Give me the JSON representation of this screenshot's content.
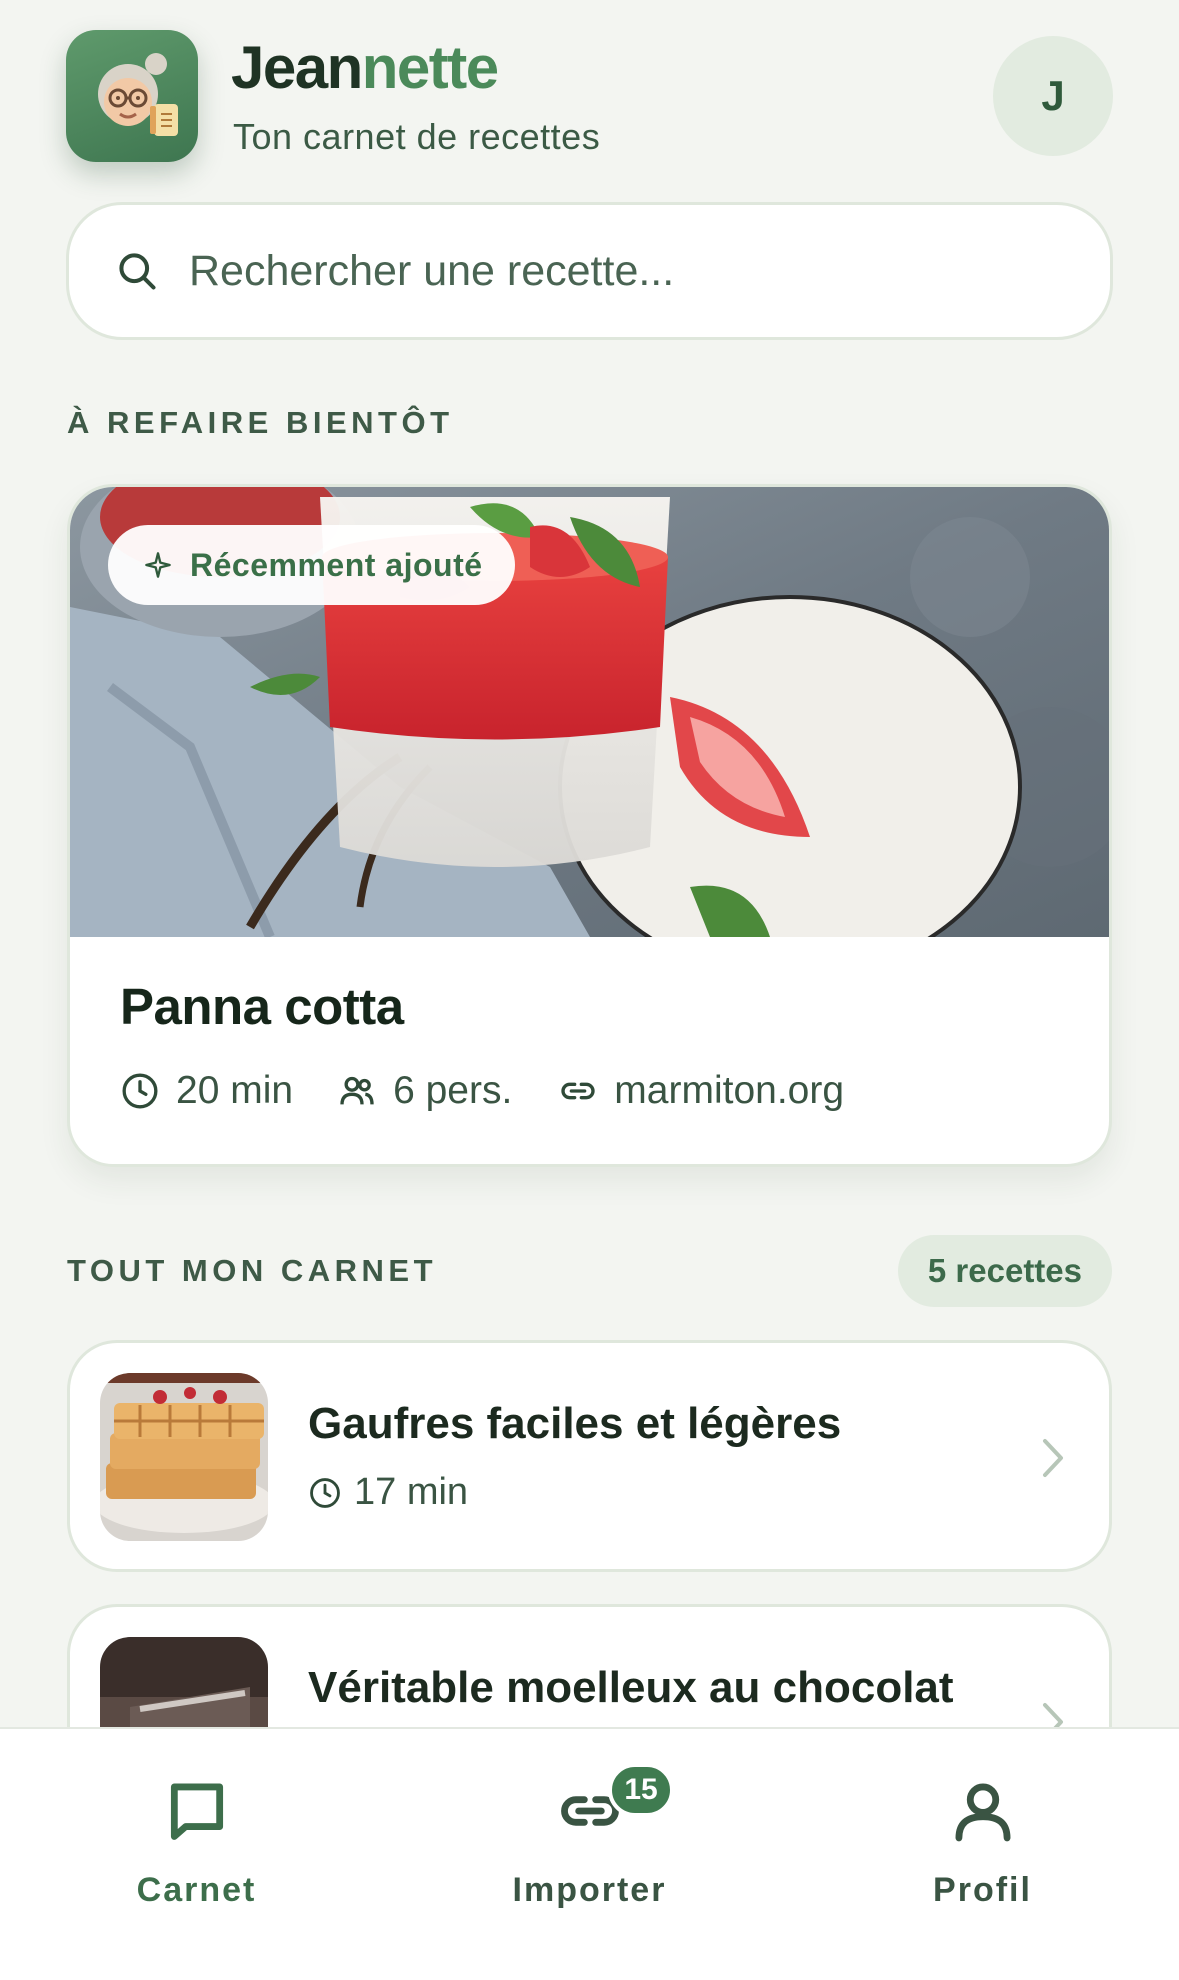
{
  "header": {
    "brand_first": "Jean",
    "brand_accent": "nette",
    "subtitle": "Ton carnet de recettes",
    "avatar_initial": "J"
  },
  "search": {
    "placeholder": "Rechercher une recette..."
  },
  "sections": {
    "soon_label": "À REFAIRE BIENTÔT",
    "all_label": "TOUT MON CARNET",
    "count": "5 recettes"
  },
  "featured": {
    "badge": "Récemment ajouté",
    "title": "Panna cotta",
    "time": "20 min",
    "servings": "6 pers.",
    "source": "marmiton.org"
  },
  "recipes": [
    {
      "title": "Gaufres faciles et légères",
      "time": "17 min"
    },
    {
      "title": "Véritable moelleux au chocolat",
      "time": ""
    }
  ],
  "nav": {
    "items": [
      {
        "label": "Carnet",
        "icon": "book-icon",
        "active": true
      },
      {
        "label": "Importer",
        "icon": "link-icon",
        "badge": "15"
      },
      {
        "label": "Profil",
        "icon": "user-icon"
      }
    ]
  },
  "colors": {
    "accent": "#4b8a5a",
    "dark_green": "#2f5a3b",
    "background": "#f3f5f1"
  }
}
